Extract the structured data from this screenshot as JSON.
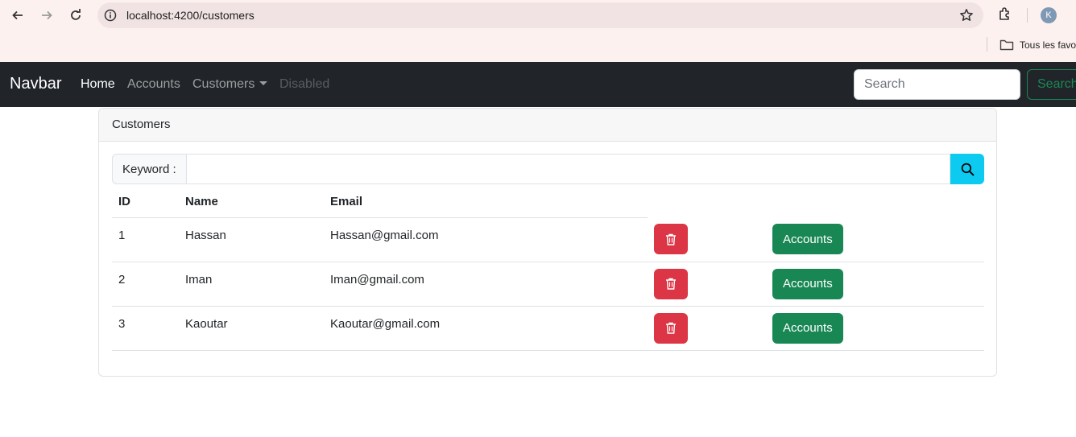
{
  "browser": {
    "url": "localhost:4200/customers",
    "profile_initial": "K",
    "bookmark_folder": "Tous les favoris"
  },
  "navbar": {
    "brand": "Navbar",
    "links": [
      {
        "label": "Home",
        "state": "active"
      },
      {
        "label": "Accounts",
        "state": "normal"
      },
      {
        "label": "Customers",
        "state": "dropdown"
      },
      {
        "label": "Disabled",
        "state": "disabled"
      }
    ],
    "search_placeholder": "Search",
    "search_button": "Search"
  },
  "card": {
    "title": "Customers",
    "keyword_label": "Keyword :",
    "keyword_value": "",
    "columns": [
      "ID",
      "Name",
      "Email"
    ],
    "rows": [
      {
        "id": "1",
        "name": "Hassan",
        "email": "Hassan@gmail.com"
      },
      {
        "id": "2",
        "name": "Iman",
        "email": "Iman@gmail.com"
      },
      {
        "id": "3",
        "name": "Kaoutar",
        "email": "Kaoutar@gmail.com"
      }
    ],
    "accounts_button": "Accounts"
  },
  "colors": {
    "navbar_bg": "#212529",
    "danger": "#dc3545",
    "success": "#198754",
    "info": "#0dcaf0"
  },
  "icons": [
    "back-arrow-icon",
    "forward-arrow-icon",
    "reload-icon",
    "info-icon",
    "star-icon",
    "extension-icon",
    "folder-icon",
    "search-icon",
    "trash-icon"
  ]
}
